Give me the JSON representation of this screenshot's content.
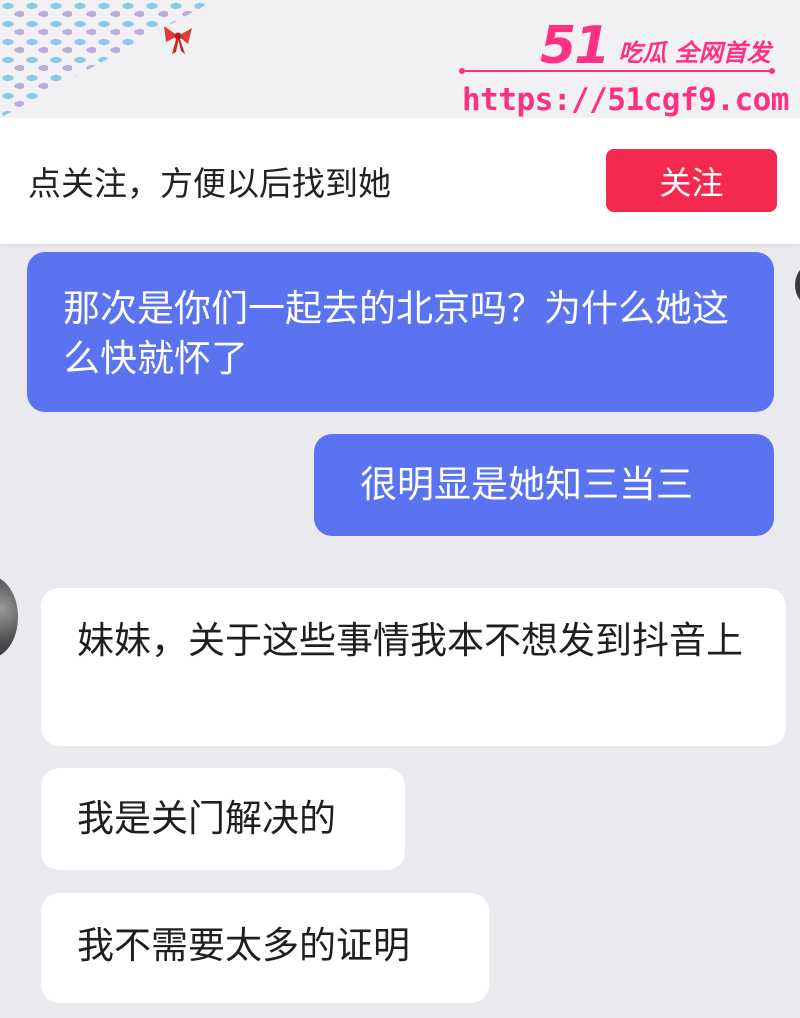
{
  "watermark": {
    "logo_number": "51",
    "logo_tagline": "吃瓜 全网首发",
    "url": "https://51cgf9.com",
    "color": "#ff2f84"
  },
  "follow_bar": {
    "prompt": "点关注，方便以后找到她",
    "button_label": "关注",
    "button_color": "#f4294f"
  },
  "chat": {
    "sent_bubble_color": "#5a73f1",
    "received_bubble_color": "#ffffff",
    "messages": [
      {
        "side": "sent",
        "text": "那次是你们一起去的北京吗？为什么她这么快就怀了"
      },
      {
        "side": "sent",
        "text": "很明显是她知三当三"
      },
      {
        "side": "received",
        "text": "妹妹，关于这些事情我本不想发到抖音上"
      },
      {
        "side": "received",
        "text": "我是关门解决的"
      },
      {
        "side": "received",
        "text": "我不需要太多的证明"
      }
    ]
  }
}
